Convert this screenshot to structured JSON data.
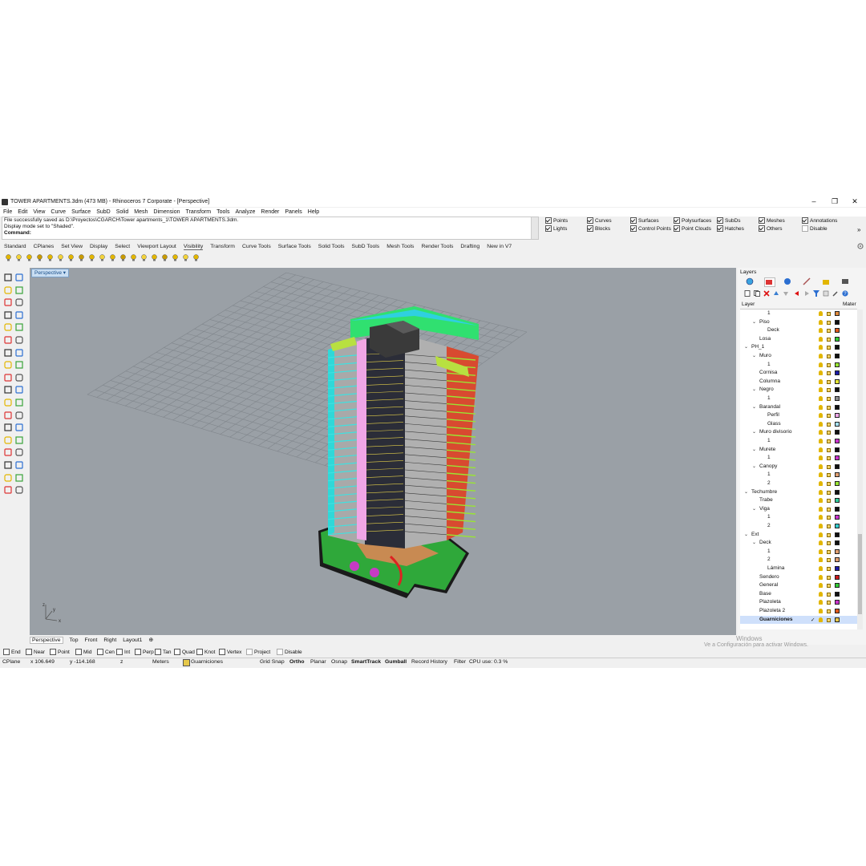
{
  "window": {
    "title": "TOWER APARTMENTS.3dm (473 MB) - Rhinoceros 7 Corporate - [Perspective]",
    "minimize": "–",
    "maximize": "❐",
    "close": "✕"
  },
  "menu": [
    "File",
    "Edit",
    "View",
    "Curve",
    "Surface",
    "SubD",
    "Solid",
    "Mesh",
    "Dimension",
    "Transform",
    "Tools",
    "Analyze",
    "Render",
    "Panels",
    "Help"
  ],
  "command": {
    "history": [
      "File successfully saved as D:\\Proyectos\\CGARCH\\Tower apartments_1\\TOWER APARTMENTS.3dm.",
      "Display mode set to \"Shaded\"."
    ],
    "prompt": "Command:"
  },
  "select_filter": [
    {
      "label": "Points",
      "checked": true
    },
    {
      "label": "Curves",
      "checked": true
    },
    {
      "label": "Surfaces",
      "checked": true
    },
    {
      "label": "Polysurfaces",
      "checked": true
    },
    {
      "label": "SubDs",
      "checked": true
    },
    {
      "label": "Meshes",
      "checked": true
    },
    {
      "label": "Annotations",
      "checked": true
    },
    {
      "label": "Lights",
      "checked": true
    },
    {
      "label": "Blocks",
      "checked": true
    },
    {
      "label": "Control Points",
      "checked": true
    },
    {
      "label": "Point Clouds",
      "checked": true
    },
    {
      "label": "Hatches",
      "checked": true
    },
    {
      "label": "Others",
      "checked": true
    },
    {
      "label": "Disable",
      "checked": false
    }
  ],
  "toolbar_tabs": [
    "Standard",
    "CPlanes",
    "Set View",
    "Display",
    "Select",
    "Viewport Layout",
    "Visibility",
    "Transform",
    "Curve Tools",
    "Surface Tools",
    "Solid Tools",
    "SubD Tools",
    "Mesh Tools",
    "Render Tools",
    "Drafting",
    "New in V7"
  ],
  "active_toolbar_tab": "Visibility",
  "viewport": {
    "label": "Perspective",
    "axis_labels": {
      "z": "z",
      "y": "y",
      "x": "x"
    }
  },
  "viewport_tabs": [
    "Perspective",
    "Top",
    "Front",
    "Right",
    "Layout1"
  ],
  "viewport_tab_add": "⊕",
  "osnaps": [
    {
      "label": "End",
      "checked": false
    },
    {
      "label": "Near",
      "checked": false
    },
    {
      "label": "Point",
      "checked": false
    },
    {
      "label": "Mid",
      "checked": false
    },
    {
      "label": "Cen",
      "checked": false
    },
    {
      "label": "Int",
      "checked": false
    },
    {
      "label": "Perp",
      "checked": false
    },
    {
      "label": "Tan",
      "checked": false
    },
    {
      "label": "Quad",
      "checked": false
    },
    {
      "label": "Knot",
      "checked": false
    },
    {
      "label": "Vertex",
      "checked": false
    },
    {
      "label": "Project",
      "checked": false
    },
    {
      "label": "Disable",
      "checked": false
    }
  ],
  "status": {
    "cplane": "CPlane",
    "x": "x 106.649",
    "y": "y -114.168",
    "z": "z",
    "units": "Meters",
    "layer": "Guarniciones",
    "grid_snap": "Grid Snap",
    "ortho": "Ortho",
    "planar": "Planar",
    "osnap": "Osnap",
    "smarttrack": "SmartTrack",
    "gumball": "Gumball",
    "record_history": "Record History",
    "filter": "Filter",
    "cpu": "CPU use: 0.3 %"
  },
  "layers_panel": {
    "title": "Layers",
    "col_layer": "Layer",
    "col_material": "Mater",
    "rows": [
      {
        "name": "1",
        "depth": 3,
        "toggle": "",
        "color": "#e08a3c"
      },
      {
        "name": "Piso",
        "depth": 2,
        "toggle": "v",
        "color": "#111111"
      },
      {
        "name": "Deck",
        "depth": 3,
        "toggle": "",
        "color": "#e05a1a"
      },
      {
        "name": "Losa",
        "depth": 2,
        "toggle": "",
        "color": "#33cc33"
      },
      {
        "name": "PH_1",
        "depth": 1,
        "toggle": "v",
        "color": "#111111"
      },
      {
        "name": "Muro",
        "depth": 2,
        "toggle": "v",
        "color": "#111111"
      },
      {
        "name": "1",
        "depth": 3,
        "toggle": "",
        "color": "#99e533"
      },
      {
        "name": "Cornisa",
        "depth": 2,
        "toggle": "",
        "color": "#1a1aa6"
      },
      {
        "name": "Columna",
        "depth": 2,
        "toggle": "",
        "color": "#e6e633"
      },
      {
        "name": "Negro",
        "depth": 2,
        "toggle": "v",
        "color": "#111111"
      },
      {
        "name": "1",
        "depth": 3,
        "toggle": "",
        "color": "#8c8c8c"
      },
      {
        "name": "Barandal",
        "depth": 2,
        "toggle": "v",
        "color": "#111111"
      },
      {
        "name": "Perfil",
        "depth": 3,
        "toggle": "",
        "color": "#f0a6e6"
      },
      {
        "name": "Glass",
        "depth": 3,
        "toggle": "",
        "color": "#a6e0f0"
      },
      {
        "name": "Muro divisorio",
        "depth": 2,
        "toggle": "v",
        "color": "#111111"
      },
      {
        "name": "1",
        "depth": 3,
        "toggle": "",
        "color": "#cc33cc"
      },
      {
        "name": "Murete",
        "depth": 2,
        "toggle": "v",
        "color": "#111111"
      },
      {
        "name": "1",
        "depth": 3,
        "toggle": "",
        "color": "#cc33cc"
      },
      {
        "name": "Canopy",
        "depth": 2,
        "toggle": "v",
        "color": "#111111"
      },
      {
        "name": "1",
        "depth": 3,
        "toggle": "",
        "color": "#e0a070"
      },
      {
        "name": "2",
        "depth": 3,
        "toggle": "",
        "color": "#99e533"
      },
      {
        "name": "Techumbre",
        "depth": 1,
        "toggle": "v",
        "color": "#111111"
      },
      {
        "name": "Trabe",
        "depth": 2,
        "toggle": "",
        "color": "#33cc99"
      },
      {
        "name": "Viga",
        "depth": 2,
        "toggle": "v",
        "color": "#111111"
      },
      {
        "name": "1",
        "depth": 3,
        "toggle": "",
        "color": "#cc33cc"
      },
      {
        "name": "2",
        "depth": 3,
        "toggle": "",
        "color": "#33cccc"
      },
      {
        "name": "Ext",
        "depth": 1,
        "toggle": "v",
        "color": "#111111"
      },
      {
        "name": "Deck",
        "depth": 2,
        "toggle": "v",
        "color": "#111111"
      },
      {
        "name": "1",
        "depth": 3,
        "toggle": "",
        "color": "#e0a070"
      },
      {
        "name": "2",
        "depth": 3,
        "toggle": "",
        "color": "#e0a070"
      },
      {
        "name": "Lámina",
        "depth": 3,
        "toggle": "",
        "color": "#1a1aa6"
      },
      {
        "name": "Sendero",
        "depth": 2,
        "toggle": "",
        "color": "#cc1a1a"
      },
      {
        "name": "General",
        "depth": 2,
        "toggle": "",
        "color": "#33cc33"
      },
      {
        "name": "Base",
        "depth": 2,
        "toggle": "",
        "color": "#111111"
      },
      {
        "name": "Plazoleta",
        "depth": 2,
        "toggle": "",
        "color": "#cc33cc"
      },
      {
        "name": "Plazoleta 2",
        "depth": 2,
        "toggle": "",
        "color": "#e05a1a"
      },
      {
        "name": "Guarniciones",
        "depth": 2,
        "toggle": "",
        "color": "#e6c84a",
        "selected": true,
        "current": "✓"
      }
    ]
  },
  "watermark": {
    "line1": "Windows",
    "line2": "Ve a Configuración para activar Windows."
  }
}
